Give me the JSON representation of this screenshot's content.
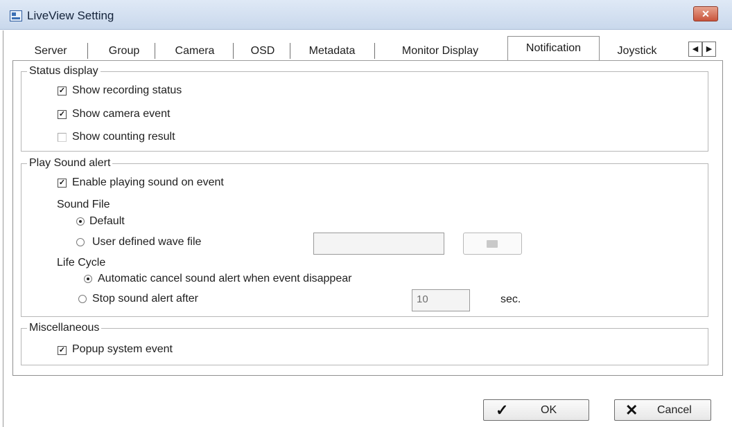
{
  "window": {
    "title": "LiveView Setting",
    "close_glyph": "✕"
  },
  "tabs": [
    {
      "label": "Server"
    },
    {
      "label": "Group"
    },
    {
      "label": "Camera"
    },
    {
      "label": "OSD"
    },
    {
      "label": "Metadata"
    },
    {
      "label": "Monitor Display"
    },
    {
      "label": "Notification",
      "active": true
    },
    {
      "label": "Joystick"
    }
  ],
  "tab_scroll": {
    "left": "◀",
    "right": "▶"
  },
  "status_display": {
    "legend": "Status display",
    "show_recording_status": {
      "label": "Show recording status",
      "checked": true
    },
    "show_camera_event": {
      "label": "Show camera event",
      "checked": true
    },
    "show_counting_result": {
      "label": "Show counting result",
      "checked": false
    }
  },
  "play_sound_alert": {
    "legend": "Play Sound alert",
    "enable_sound": {
      "label": "Enable playing sound on event",
      "checked": true
    },
    "sound_file_label": "Sound File",
    "default_option": {
      "label": "Default",
      "selected": true
    },
    "user_defined_option": {
      "label": "User defined wave file",
      "selected": false
    },
    "wave_file_value": "",
    "life_cycle_label": "Life Cycle",
    "automatic_cancel_option": {
      "label": "Automatic cancel sound alert when event disappear",
      "selected": true
    },
    "stop_after_option": {
      "label": "Stop sound alert after",
      "selected": false
    },
    "stop_after_seconds": "10",
    "seconds_unit": "sec."
  },
  "miscellaneous": {
    "legend": "Miscellaneous",
    "popup_system_event": {
      "label": "Popup system event",
      "checked": true
    }
  },
  "buttons": {
    "ok_label": "OK",
    "ok_glyph": "✓",
    "cancel_label": "Cancel",
    "cancel_glyph": "✕"
  },
  "check_glyph": "✓"
}
